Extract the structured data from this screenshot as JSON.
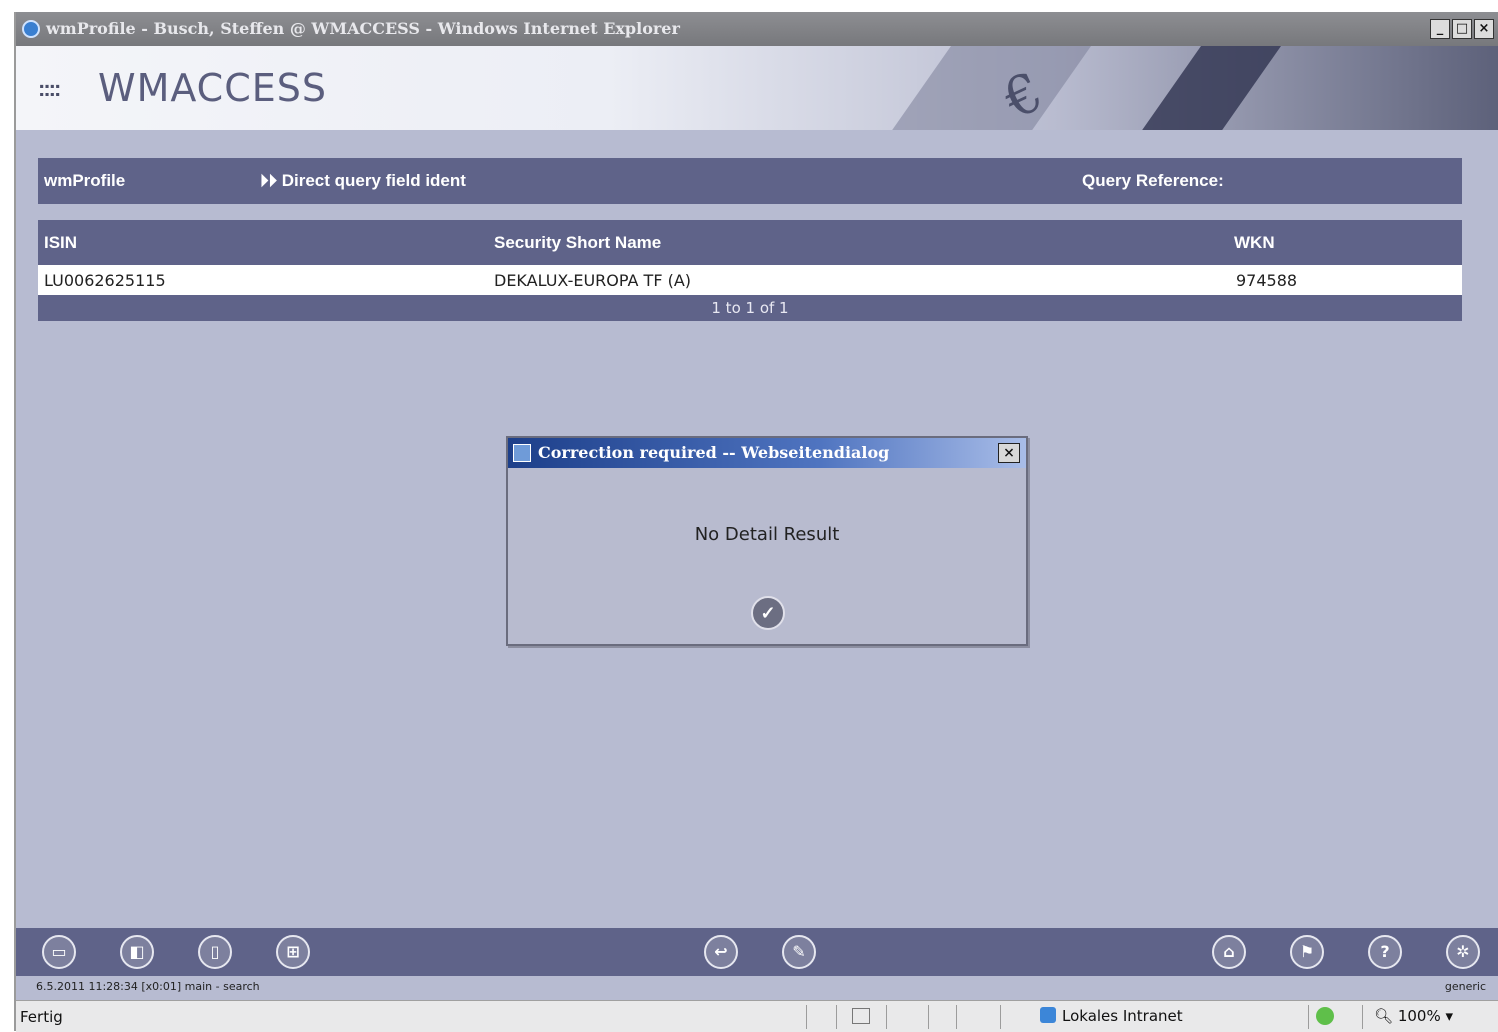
{
  "window": {
    "title": "wmProfile - Busch, Steffen @ WMACCESS - Windows Internet Explorer",
    "minimize": "_",
    "maximize": "□",
    "close": "×"
  },
  "banner": {
    "dots": "::::",
    "brand": "WMACCESS",
    "euro": "€"
  },
  "header": {
    "app": "wmProfile",
    "mode": "⏵⏵ Direct query field ident",
    "query_reference_label": "Query Reference:"
  },
  "table": {
    "columns": [
      "ISIN",
      "Security Short Name",
      "WKN"
    ],
    "rows": [
      [
        "LU0062625115",
        "DEKALUX-EUROPA TF (A)",
        "974588"
      ]
    ],
    "pager": "1 to 1  of 1"
  },
  "dialog": {
    "title": "Correction required -- Webseitendialog",
    "close": "×",
    "message": "No Detail Result",
    "ok": "✓"
  },
  "toolbar": {
    "buttons": [
      {
        "name": "toolbar-button-1",
        "glyph": "▭"
      },
      {
        "name": "toolbar-button-2",
        "glyph": "◧"
      },
      {
        "name": "toolbar-button-3",
        "glyph": "▯"
      },
      {
        "name": "toolbar-button-4",
        "glyph": "⊞"
      },
      {
        "name": "toolbar-button-5",
        "glyph": "↩"
      },
      {
        "name": "toolbar-button-6",
        "glyph": "✎"
      },
      {
        "name": "home-button",
        "glyph": "⌂"
      },
      {
        "name": "flag-button",
        "glyph": "⚑"
      },
      {
        "name": "help-button",
        "glyph": "?"
      },
      {
        "name": "settings-button",
        "glyph": "✲"
      }
    ]
  },
  "info": {
    "left": "6.5.2011 11:28:34 [x0:01] main - search",
    "right": "generic"
  },
  "statusbar": {
    "status": "Fertig",
    "zone": "Lokales Intranet",
    "zoom": "100%"
  }
}
